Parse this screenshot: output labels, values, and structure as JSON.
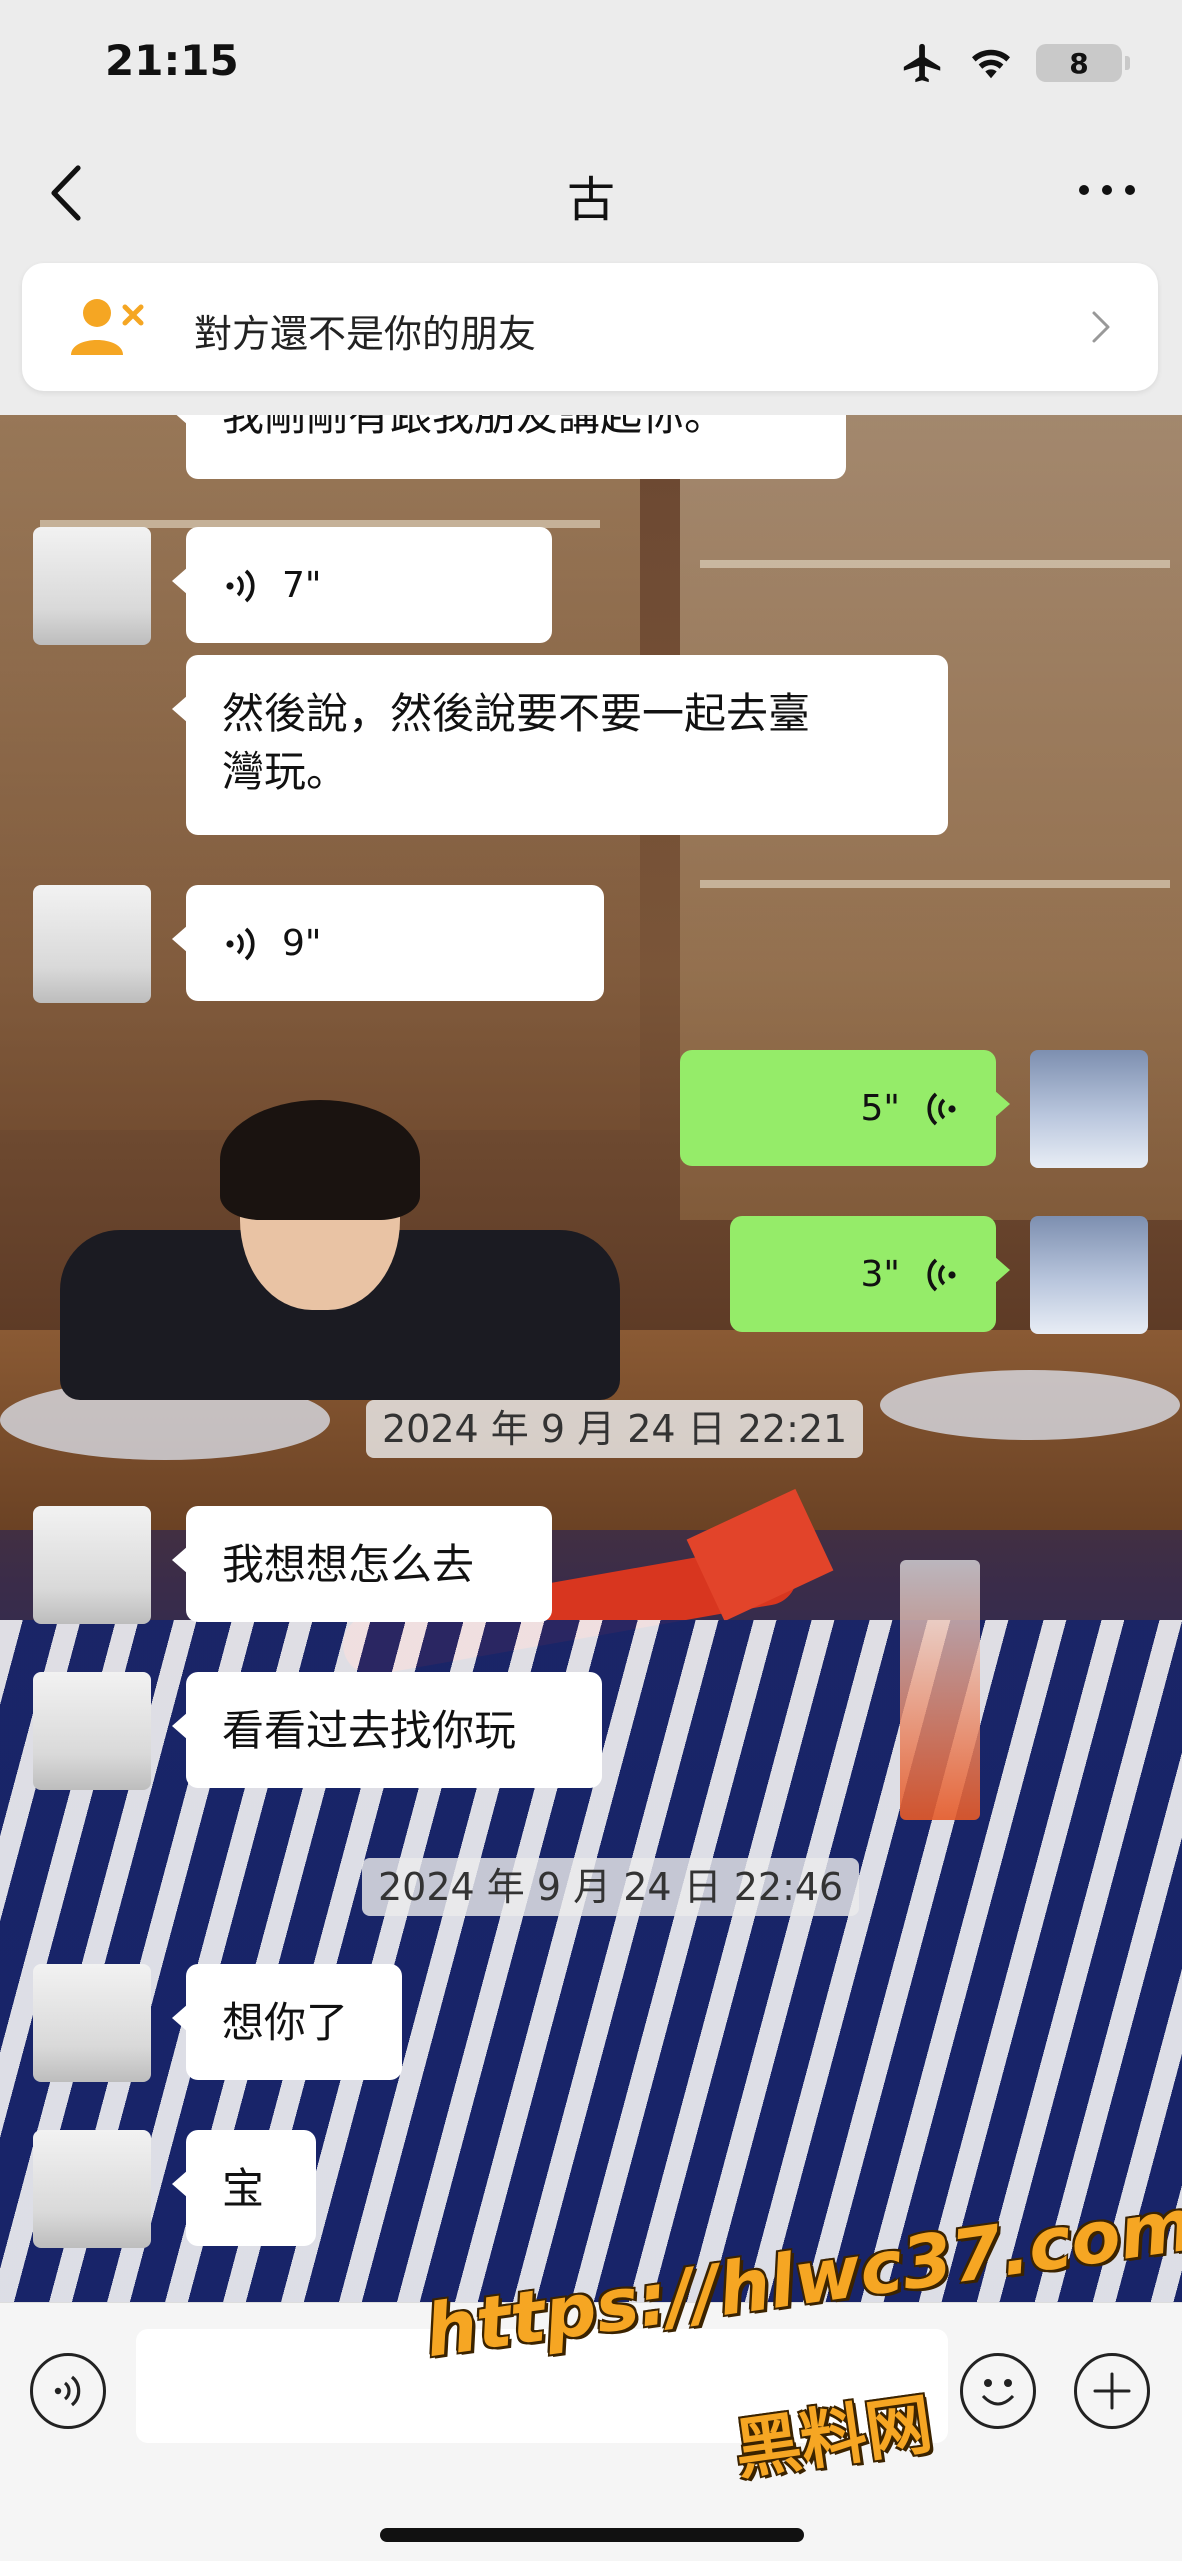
{
  "status_bar": {
    "time": "21:15",
    "battery": "8"
  },
  "nav": {
    "title": "古"
  },
  "notice": {
    "text": "對方還不是你的朋友"
  },
  "messages": [
    {
      "side": "left",
      "kind": "text",
      "text": "我剛剛有跟我朋友講起你。"
    },
    {
      "side": "left",
      "kind": "voice",
      "duration": "7\""
    },
    {
      "side": "left",
      "kind": "text",
      "lines": [
        "然後說，然後說要不要一起去臺",
        "灣玩。"
      ]
    },
    {
      "side": "left",
      "kind": "voice",
      "duration": "9\""
    },
    {
      "side": "right",
      "kind": "voice",
      "duration": "5\""
    },
    {
      "side": "right",
      "kind": "voice",
      "duration": "3\""
    },
    {
      "kind": "timestamp",
      "text": "2024 年 9 月 24 日 22:21"
    },
    {
      "side": "left",
      "kind": "text",
      "text": "我想想怎么去"
    },
    {
      "side": "left",
      "kind": "text",
      "text": "看看过去找你玩"
    },
    {
      "kind": "timestamp",
      "text": "2024 年 9 月 24 日 22:46"
    },
    {
      "side": "left",
      "kind": "text",
      "text": "想你了"
    },
    {
      "side": "left",
      "kind": "text",
      "text": "宝"
    }
  ],
  "input": {
    "value": ""
  },
  "watermark": {
    "url": "https://hlwc37.com",
    "name": "黑料网"
  },
  "colors": {
    "outgoing_bubble": "#95ec69",
    "incoming_bubble": "#ffffff",
    "notice_icon": "#f5a623"
  },
  "icons": [
    "back-icon",
    "more-icon",
    "user-remove-icon",
    "chevron-right-icon",
    "voice-wave-icon",
    "emoji-icon",
    "plus-icon",
    "airplane-icon",
    "wifi-icon"
  ]
}
